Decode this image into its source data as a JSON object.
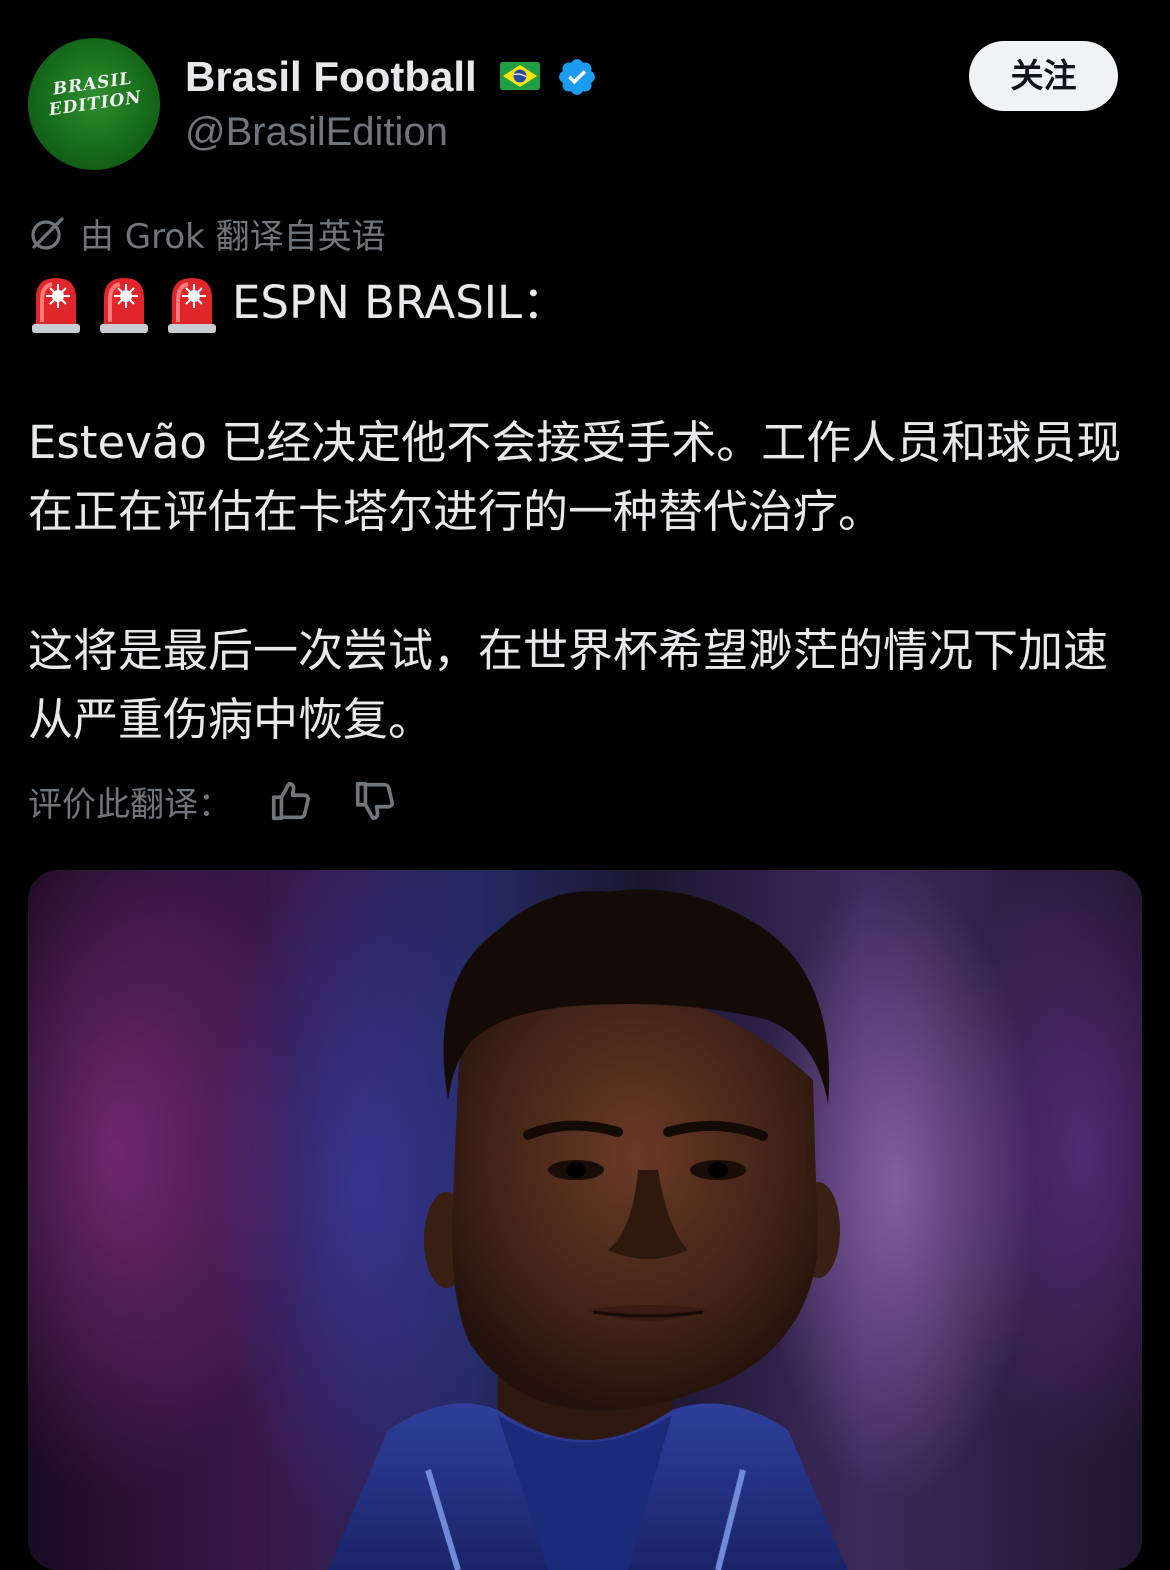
{
  "author": {
    "avatar_text_line1": "BRASIL",
    "avatar_text_line2": "EDITION",
    "display_name": "Brasil Football",
    "flag": "brazil-flag-emoji",
    "handle": "@BrasilEdition",
    "verified": true
  },
  "follow_label": "关注",
  "translation": {
    "label": "由 Grok 翻译自英语",
    "rate_label": "评价此翻译："
  },
  "tweet": {
    "emoji": "rotating-light-siren x3",
    "headline": "ESPN BRASIL：",
    "paragraph1": "Estevão 已经决定他不会接受手术。工作人员和球员现在正在评估在卡塔尔进行的一种替代治疗。",
    "paragraph2": "这将是最后一次尝试，在世界杯希望渺茫的情况下加速从严重伤病中恢复。"
  },
  "media": {
    "kind": "photo",
    "subject": "player-portrait"
  },
  "colors": {
    "background": "#000000",
    "text": "#e7e9ea",
    "muted": "#71767b",
    "verified": "#1d9bf0",
    "follow_bg": "#eff3f4"
  }
}
